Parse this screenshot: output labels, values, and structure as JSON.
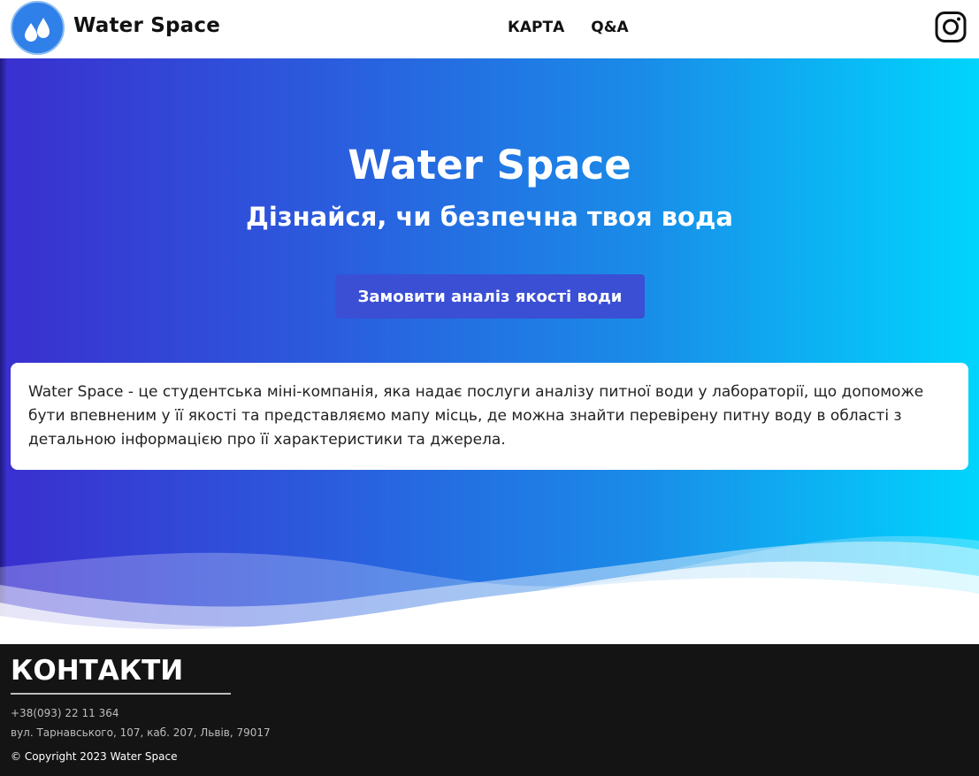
{
  "header": {
    "brand": "Water Space",
    "logo_icon": "water-drops-icon",
    "nav": [
      {
        "label": "КАРТА"
      },
      {
        "label": "Q&A"
      }
    ],
    "social_icon": "instagram-icon"
  },
  "hero": {
    "title": "Water Space",
    "subtitle": "Дізнайся, чи безпечна твоя вода",
    "cta_label": "Замовити аналіз якості води",
    "description": "Water Space - це студентська міні-компанія, яка надає послуги аналізу питної води у лабораторії, що допоможе бути впевненим у її якості та представляємо мапу місць, де можна знайти перевірену питну воду в області з детальною інформацією про її характеристики та джерела.",
    "colors": {
      "gradient_start": "#3a2fcf",
      "gradient_end": "#00d5fd",
      "button": "#3a4fd4"
    }
  },
  "footer": {
    "title": "КОНТАКТИ",
    "phone": "+38(093) 22 11 364",
    "address": "вул. Тарнавського, 107, каб. 207, Львів, 79017",
    "copyright": "© Copyright 2023 Water Space",
    "background": "#141414"
  }
}
